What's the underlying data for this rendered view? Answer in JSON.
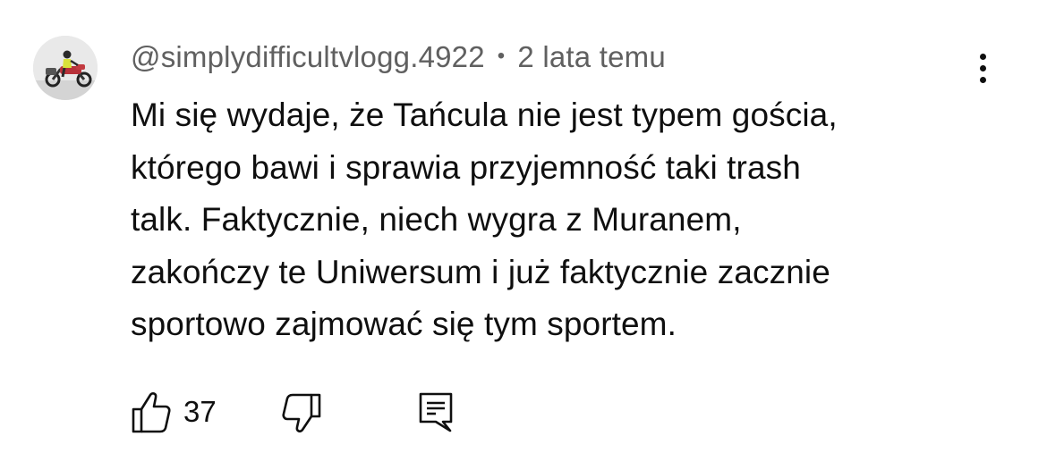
{
  "comment": {
    "author": "@simplydifficultvlogg.4922",
    "separator": "•",
    "timestamp": "2 lata temu",
    "text_lines": [
      "Mi się wydaje, że Tańcula nie jest typem gościa,",
      "którego bawi i sprawia przyjemność taki trash",
      "talk. Faktycznie, niech wygra z Muranem,",
      "zakończy te Uniwersum i już faktycznie zacznie",
      "sportowo zajmować się tym sportem."
    ],
    "like_count": "37",
    "avatar_icon": "motorcycle-rider-avatar",
    "menu_icon": "more-vertical-icon"
  },
  "actions": {
    "like_icon": "thumb-up-icon",
    "dislike_icon": "thumb-down-icon",
    "reply_icon": "reply-comment-icon"
  },
  "colors": {
    "text_primary": "#0f0f0f",
    "text_secondary": "#606060",
    "background": "#ffffff"
  }
}
